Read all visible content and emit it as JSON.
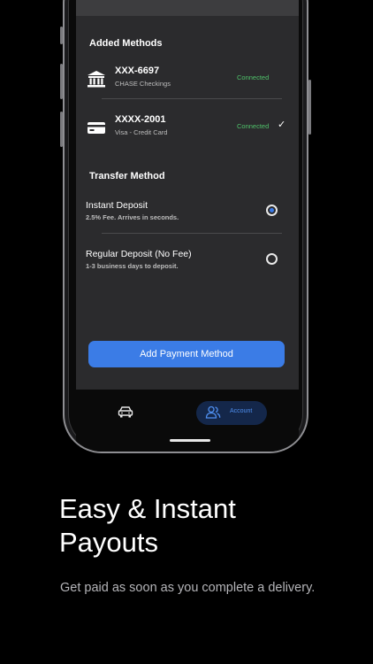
{
  "added_methods": {
    "title": "Added Methods",
    "items": [
      {
        "name": "XXX-6697",
        "subtitle": "CHASE Checkings",
        "status": "Connected",
        "icon": "bank-icon",
        "selected": false
      },
      {
        "name": "XXXX-2001",
        "subtitle": "Visa - Credit Card",
        "status": "Connected",
        "icon": "credit-card-icon",
        "selected": true,
        "check": "✓"
      }
    ]
  },
  "transfer_method": {
    "title": "Transfer Method",
    "options": [
      {
        "name": "Instant Deposit",
        "subtitle": "2.5% Fee. Arrives in seconds.",
        "selected": true
      },
      {
        "name": "Regular Deposit (No Fee)",
        "subtitle": "1-3 business days to deposit.",
        "selected": false
      }
    ]
  },
  "add_button_label": "Add Payment Method",
  "tabbar": {
    "car_icon": "car-icon",
    "account_icon": "people-icon",
    "account_label": "Account"
  },
  "promo": {
    "headline_line1": "Easy & Instant",
    "headline_line2": "Payouts",
    "subtext": "Get paid as soon as you complete a delivery."
  },
  "colors": {
    "accent": "#3b7ce6",
    "connected": "#4fc16a",
    "background": "#000000",
    "screen": "#2b2b2d"
  }
}
